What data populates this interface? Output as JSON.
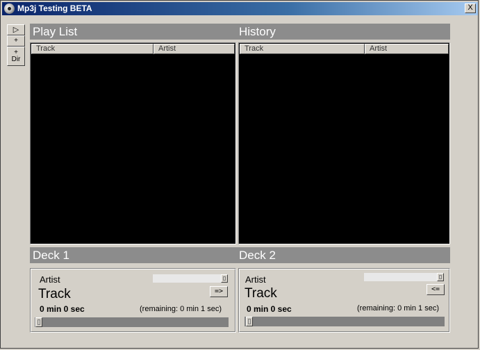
{
  "window": {
    "title": "Mp3j Testing BETA",
    "close_glyph": "X"
  },
  "toolbar": {
    "play_glyph": "▷",
    "add_label": "+",
    "add_dir_label_top": "+",
    "add_dir_label_bottom": "Dir"
  },
  "playlist": {
    "title": "Play List",
    "columns": [
      "Track",
      "Artist"
    ]
  },
  "history": {
    "title": "History",
    "columns": [
      "Track",
      "Artist"
    ]
  },
  "deck1": {
    "title": "Deck 1",
    "artist": "Artist",
    "track": "Track",
    "time": "0 min 0 sec",
    "remaining": "(remaining: 0 min 1 sec)",
    "transfer_label": "=>"
  },
  "deck2": {
    "title": "Deck 2",
    "artist": "Artist",
    "track": "Track",
    "time": "0 min 0 sec",
    "remaining": "(remaining: 0 min 1 sec)",
    "transfer_label": "<="
  },
  "colors": {
    "titlebar_start": "#0a246a",
    "section_header": "#8c8c8c",
    "list_background": "#000000",
    "window_face": "#d4d0c8"
  }
}
